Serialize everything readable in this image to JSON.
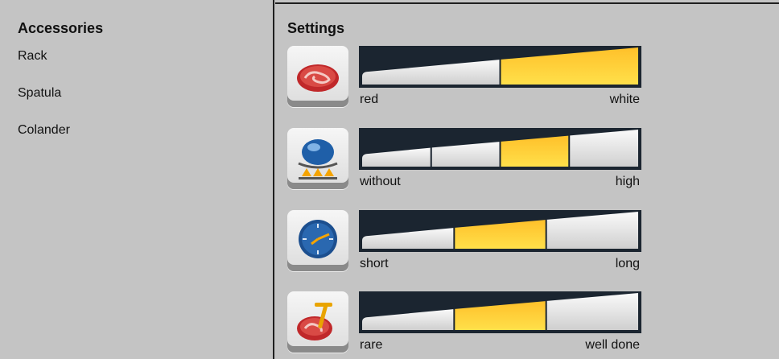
{
  "accessories": {
    "heading": "Accessories",
    "items": [
      "Rack",
      "Spatula",
      "Colander"
    ]
  },
  "settings": {
    "heading": "Settings",
    "rows": [
      {
        "icon": "meat-red-white-icon",
        "low": "red",
        "high": "white",
        "segments": 2,
        "selected": 2,
        "style": "wedge"
      },
      {
        "icon": "browning-steam-icon",
        "low": "without",
        "high": "high",
        "segments": 4,
        "selected": 3,
        "style": "wedge"
      },
      {
        "icon": "clock-duration-icon",
        "low": "short",
        "high": "long",
        "segments": 3,
        "selected": 2,
        "style": "wedge"
      },
      {
        "icon": "meat-doneness-icon",
        "low": "rare",
        "high": "well done",
        "segments": 3,
        "selected": 2,
        "style": "wedge"
      }
    ]
  },
  "colors": {
    "background": "#c4c4c4",
    "slider_bg": "#1b2530",
    "selected_fill": "#ffc02a",
    "unselected_fill": "#e6e6e6"
  }
}
